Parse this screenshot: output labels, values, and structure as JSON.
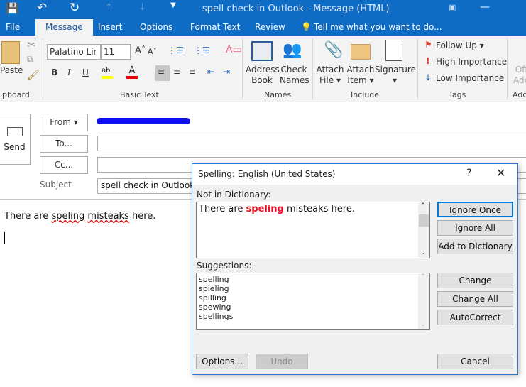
{
  "window": {
    "title": "spell check in Outlook - Message (HTML)"
  },
  "tabs": [
    {
      "label": "File"
    },
    {
      "label": "Message"
    },
    {
      "label": "Insert"
    },
    {
      "label": "Options"
    },
    {
      "label": "Format Text"
    },
    {
      "label": "Review"
    }
  ],
  "tell_me": "Tell me what you want to do...",
  "ribbon": {
    "clipboard": {
      "paste": "Paste",
      "group": "ipboard"
    },
    "basic_text": {
      "font": "Palatino Lir",
      "size": "11",
      "group": "Basic Text"
    },
    "names": {
      "address_book": [
        "Address",
        "Book"
      ],
      "check_names": [
        "Check",
        "Names"
      ],
      "group": "Names"
    },
    "include": {
      "attach_file": [
        "Attach",
        "File"
      ],
      "attach_item": [
        "Attach",
        "Item"
      ],
      "signature": "Signature",
      "group": "Include"
    },
    "tags": {
      "follow_up": "Follow Up",
      "high": "High Importance",
      "low": "Low Importance",
      "group": "Tags"
    },
    "addins": {
      "label": [
        "Off",
        "Add"
      ],
      "group": "Add"
    }
  },
  "compose": {
    "send": "Send",
    "from": "From",
    "to": "To...",
    "cc": "Cc...",
    "subject_label": "Subject",
    "subject": "spell check in Outlook",
    "body": "There are speling misteaks here.",
    "body_pre": "There are ",
    "err1": "speling",
    "err2": "misteaks",
    "body_post": " here."
  },
  "dialog": {
    "title": "Spelling: English (United States)",
    "help": "?",
    "not_in_dict": "Not in Dictionary:",
    "sentence_pre": "There are ",
    "sentence_err": "speling",
    "sentence_post": " misteaks here.",
    "suggestions_label": "Suggestions:",
    "suggestions": [
      "spelling",
      "spieling",
      "spilling",
      "spewing",
      "spellings"
    ],
    "buttons": {
      "ignore_once": "Ignore Once",
      "ignore_all": "Ignore All",
      "add": "Add to Dictionary",
      "change": "Change",
      "change_all": "Change All",
      "autocorrect": "AutoCorrect",
      "options": "Options...",
      "undo": "Undo",
      "cancel": "Cancel"
    }
  },
  "colors": {
    "titlebar": "#0f6cc4",
    "error": "#e81123",
    "focus": "#0078d7"
  }
}
